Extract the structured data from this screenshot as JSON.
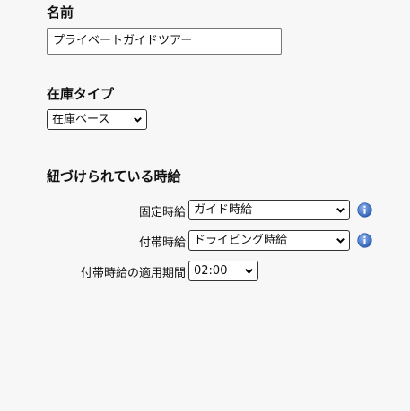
{
  "name_section": {
    "label": "名前",
    "value": "プライベートガイドツアー"
  },
  "stock_section": {
    "label": "在庫タイプ",
    "selected": "在庫ベース"
  },
  "wage_section": {
    "title": "紐づけられている時給",
    "fixed_wage": {
      "label": "固定時給",
      "selected": "ガイド時給"
    },
    "extra_wage": {
      "label": "付帯時給",
      "selected": "ドライビング時給"
    },
    "extra_period": {
      "label": "付帯時給の適用期間",
      "selected": "02:00"
    }
  },
  "colors": {
    "info": "#3f73c9",
    "border": "#333333"
  }
}
